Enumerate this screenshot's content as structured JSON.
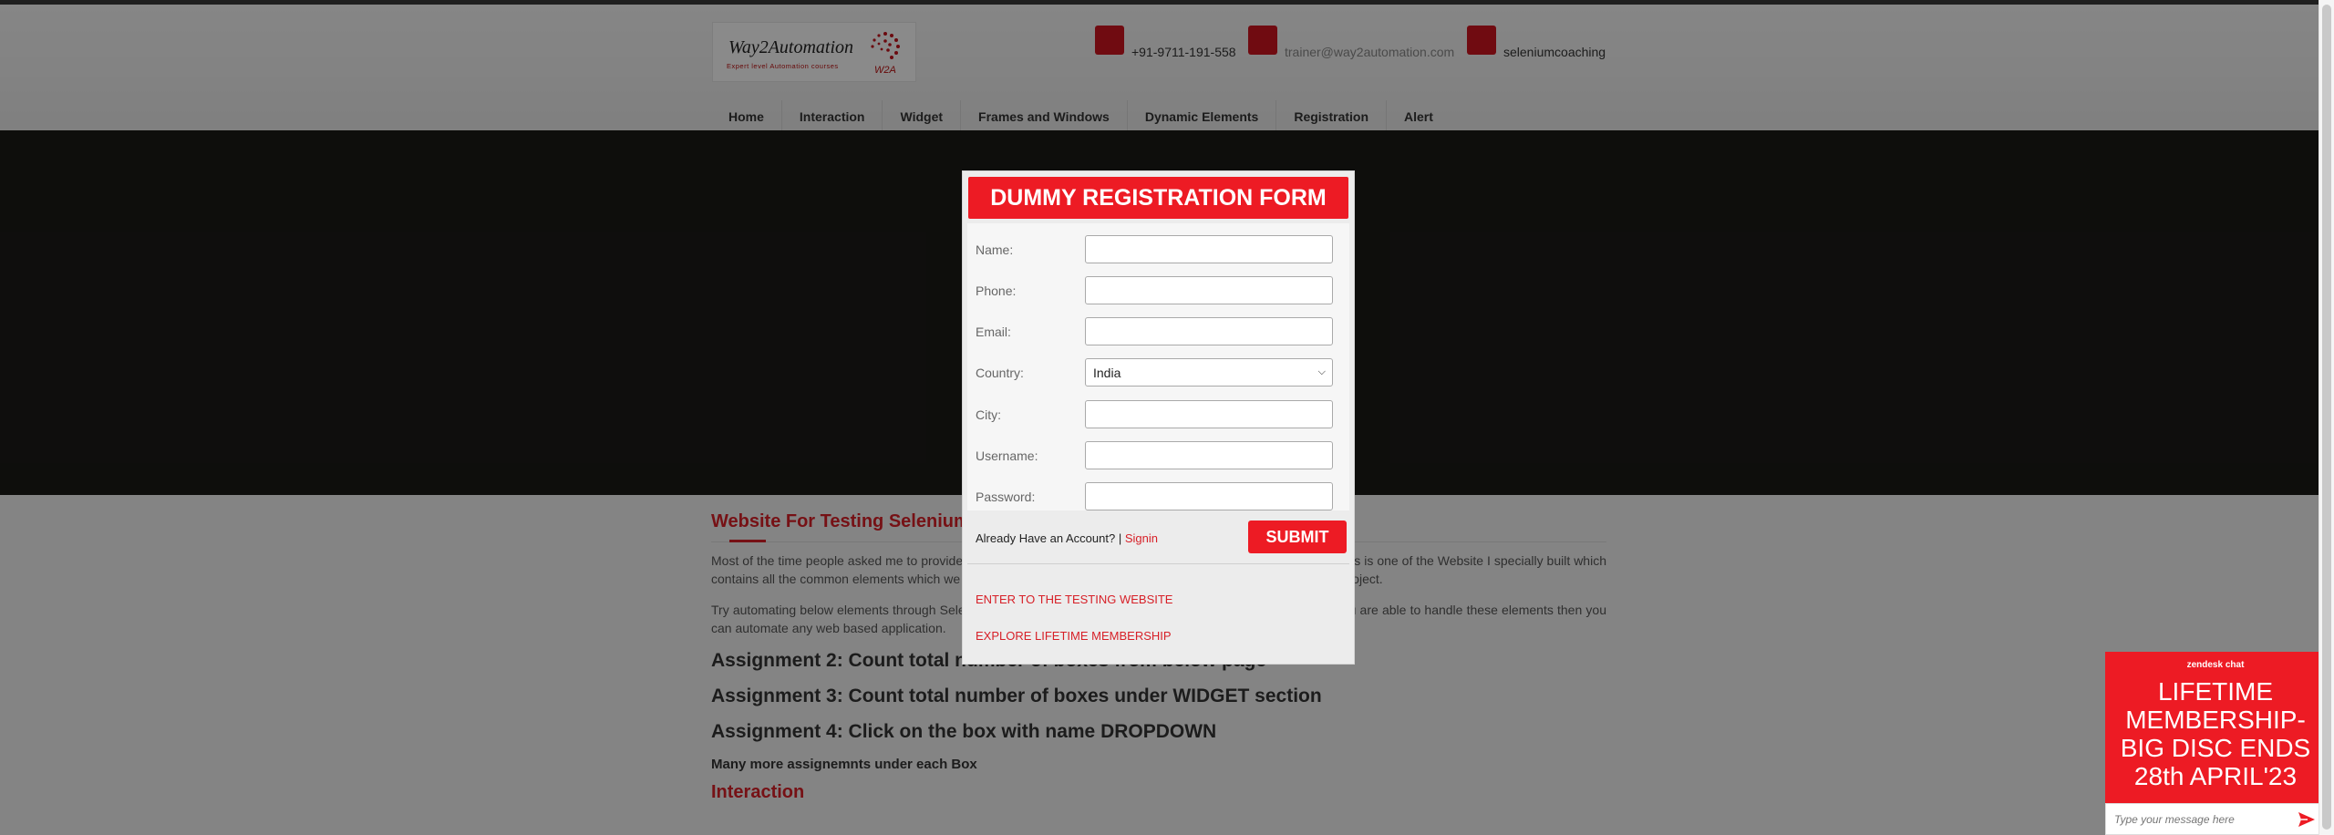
{
  "header": {
    "logo": {
      "name": "Way2Automation",
      "tagline": "Expert level Automation courses",
      "mark": "W2A"
    },
    "contacts": [
      {
        "icon": "phone-icon",
        "text": "+91-9711-191-558"
      },
      {
        "icon": "email-icon",
        "text": "trainer@way2automation.com"
      },
      {
        "icon": "skype-icon",
        "text": "seleniumcoaching"
      }
    ]
  },
  "nav": {
    "items": [
      "Home",
      "Interaction",
      "Widget",
      "Frames and Windows",
      "Dynamic Elements",
      "Registration",
      "Alert"
    ]
  },
  "content": {
    "title": "Website For Testing Selenium",
    "para1": "Most of the time people asked me to provide a website where they can practice their Selenium or QTP scripts. This is one of the Website I specially built which contains all the common elements which we come across mostly while performing Automation on a Web based project.",
    "para2": "Try automating below elements through Selenium and you will be confident in executing automation scripts. If you are able to handle these elements then you can automate any web based application.",
    "assignments": [
      "Assignment 2: Count total number of boxes from below page",
      "Assignment 3: Count total number of boxes under WIDGET section",
      "Assignment 4: Click on the box with name DROPDOWN"
    ],
    "many_more": "Many more assignemnts under each Box",
    "interaction_heading": "Interaction"
  },
  "modal": {
    "title": "DUMMY REGISTRATION FORM",
    "fields": {
      "name": {
        "label": "Name:",
        "value": ""
      },
      "phone": {
        "label": "Phone:",
        "value": ""
      },
      "email": {
        "label": "Email:",
        "value": ""
      },
      "country": {
        "label": "Country:",
        "value": "India"
      },
      "city": {
        "label": "City:",
        "value": ""
      },
      "username": {
        "label": "Username:",
        "value": ""
      },
      "password": {
        "label": "Password:",
        "value": ""
      }
    },
    "have_account": "Already Have an Account? |",
    "signin": "Signin",
    "submit": "SUBMIT",
    "enter_link": "ENTER TO THE TESTING WEBSITE",
    "explore_link": "EXPLORE LIFETIME MEMBERSHIP"
  },
  "zendesk": {
    "brand": "zendesk chat",
    "promo_lines": [
      "LIFETIME",
      "MEMBERSHIP-",
      "BIG DISC ENDS",
      "28th APRIL'23"
    ],
    "placeholder": "Type your message here"
  },
  "colors": {
    "accent": "#ed1b24",
    "link": "#d71f27",
    "banner": "#1b1a17"
  }
}
